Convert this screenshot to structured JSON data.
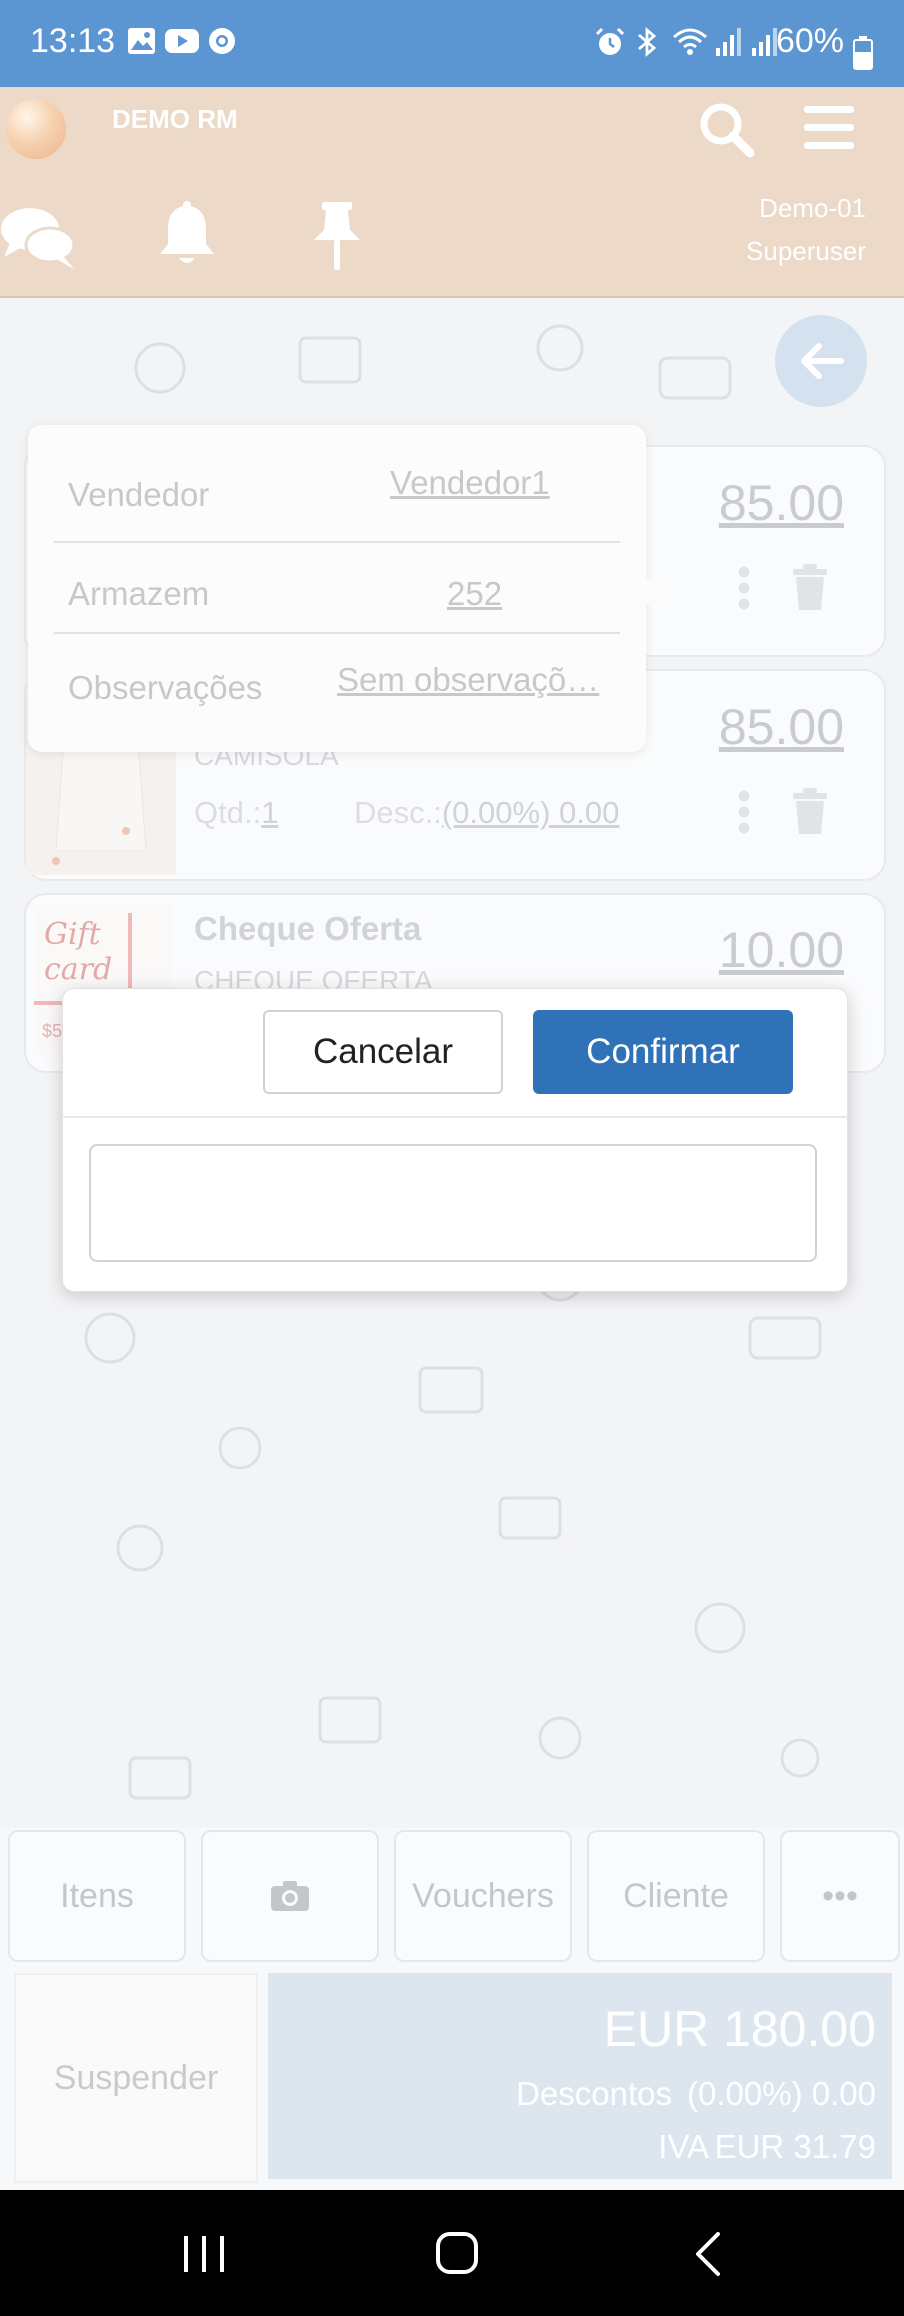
{
  "status_bar": {
    "time": "13:13",
    "battery": "60%",
    "icons": [
      "gallery-icon",
      "youtube-icon",
      "chrome-icon",
      "alarm-icon",
      "bluetooth-icon",
      "wifi-icon",
      "signal-icon",
      "signal-icon",
      "battery-icon"
    ]
  },
  "header": {
    "app_title": "DEMO RM",
    "user_line1": "Demo-01",
    "user_line2": "Superuser",
    "icons": [
      "chat-icon",
      "bell-icon",
      "pin-icon",
      "search-icon",
      "menu-icon"
    ]
  },
  "popover": {
    "rows": [
      {
        "label": "Vendedor",
        "value": "Vendedor1"
      },
      {
        "label": "Armazem",
        "value": "252"
      },
      {
        "label": "Observações",
        "value": "Sem observaçõ…"
      }
    ]
  },
  "items": [
    {
      "price": "85.00"
    },
    {
      "sub": "CAMISOLA",
      "qty_label": "Qtd.:",
      "qty": "1",
      "disc_label": "Desc.:",
      "disc": "(0.00%) 0.00",
      "price": "85.00"
    },
    {
      "name": "Cheque Oferta",
      "sub": "CHEQUE OFERTA",
      "price": "10.00",
      "image_text": "Gift card",
      "image_price": "$5"
    }
  ],
  "dialog": {
    "cancel": "Cancelar",
    "confirm": "Confirmar",
    "input_value": ""
  },
  "toolbar": {
    "items": "Itens",
    "vouchers": "Vouchers",
    "client": "Cliente",
    "more": "•••"
  },
  "footer": {
    "suspend": "Suspender",
    "total": "EUR 180.00",
    "discounts_label": "Descontos",
    "discounts_value": "(0.00%) 0.00",
    "vat_label": "IVA",
    "vat_value": "EUR 31.79"
  },
  "colors": {
    "status_bar": "#5b95d2",
    "header": "#ecd9c8",
    "confirm_button": "#2f72b8"
  }
}
